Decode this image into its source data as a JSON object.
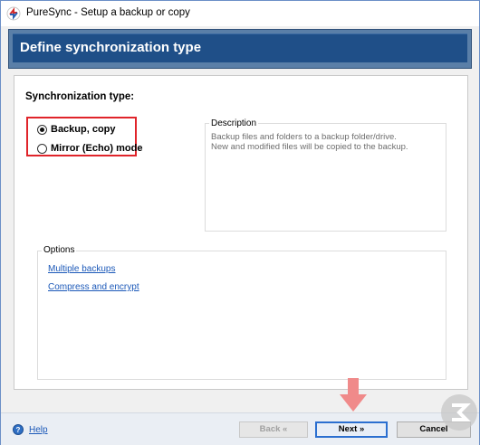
{
  "window": {
    "title": "PureSync - Setup a backup or copy"
  },
  "banner": {
    "title": "Define synchronization type"
  },
  "sync": {
    "label": "Synchronization type:",
    "options": [
      {
        "label": "Backup, copy",
        "selected": true
      },
      {
        "label": "Mirror (Echo) mode",
        "selected": false
      }
    ]
  },
  "description": {
    "legend": "Description",
    "text": "Backup files and folders to a backup folder/drive.\nNew and modified files will be copied to the backup."
  },
  "options": {
    "legend": "Options",
    "links": [
      "Multiple backups",
      "Compress and encrypt"
    ]
  },
  "footer": {
    "help": "Help",
    "back": "Back «",
    "next": "Next »",
    "cancel": "Cancel"
  },
  "colors": {
    "banner": "#1f4f88",
    "highlight_box": "#e0242a",
    "arrow": "#f08a8a",
    "link": "#1b58b8"
  },
  "icons": {
    "app": "puresync-app-icon",
    "help": "help-icon",
    "arrow": "down-arrow-icon"
  }
}
